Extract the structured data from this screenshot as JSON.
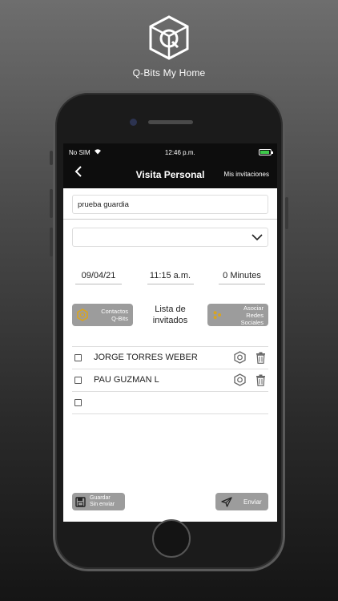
{
  "brand": {
    "name": "Q-Bits My Home",
    "logo": "qbits-cube-logo"
  },
  "statusbar": {
    "carrier": "No SIM",
    "time": "12:46 p.m.",
    "battery_level": 0.9,
    "battery_color": "#3ec94a"
  },
  "navbar": {
    "back_icon": "chevron-left-icon",
    "title": "Visita Personal",
    "right_link": "Mis invitaciones"
  },
  "form": {
    "name_value": "prueba guardia",
    "select_value": "",
    "date": "09/04/21",
    "time": "11:15 a.m.",
    "duration": "0 Minutes"
  },
  "actions": {
    "contactos_label_1": "Contactos",
    "contactos_label_2": "Q-Bits",
    "lista_label_1": "Lista de",
    "lista_label_2": "invitados",
    "asociar_label_1": "Asociar",
    "asociar_label_2": "Redes Sociales"
  },
  "guests": [
    {
      "name": "JORGE TORRES WEBER",
      "checked": false
    },
    {
      "name": "PAU GUZMAN L",
      "checked": false
    },
    {
      "name": "",
      "checked": false
    }
  ],
  "footer": {
    "save_label_1": "Guardar",
    "save_label_2": "Sin enviar",
    "send_label": "Enviar"
  },
  "colors": {
    "button_gray": "#9c9c9c",
    "bar_black": "#0d0d0d",
    "accent_gold": "#d9a520"
  }
}
